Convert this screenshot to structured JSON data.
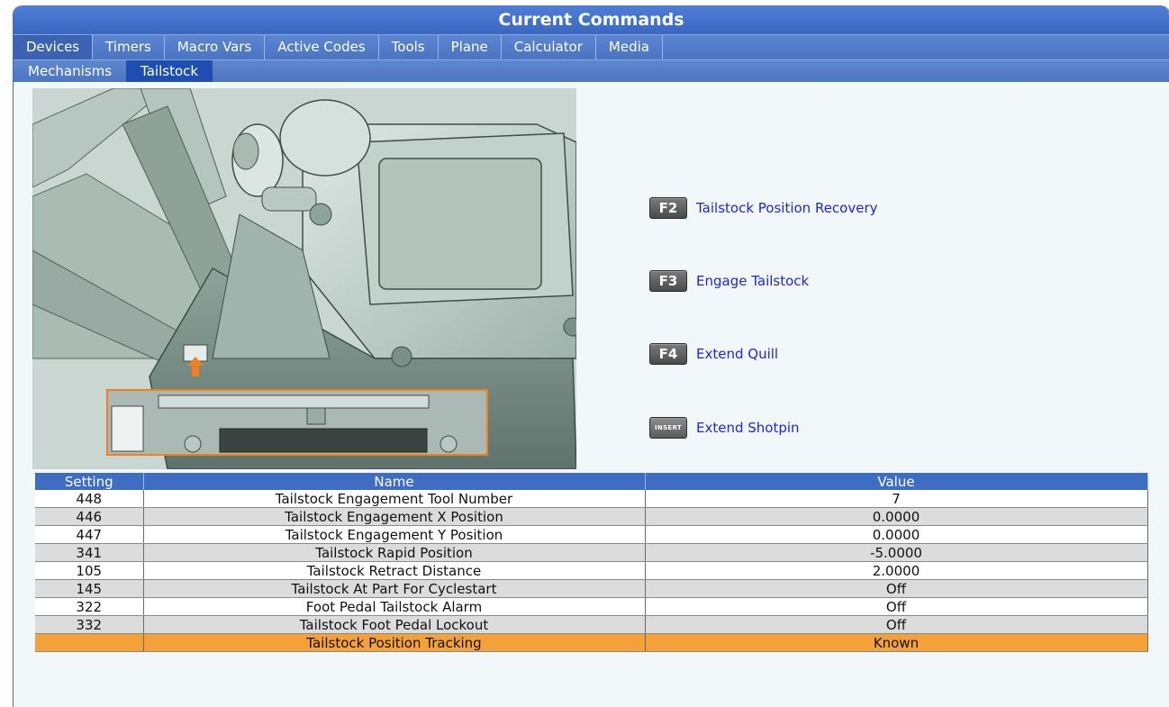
{
  "window": {
    "title": "Current Commands"
  },
  "tabs": [
    {
      "label": "Devices",
      "active": true
    },
    {
      "label": "Timers"
    },
    {
      "label": "Macro Vars"
    },
    {
      "label": "Active Codes"
    },
    {
      "label": "Tools"
    },
    {
      "label": "Plane"
    },
    {
      "label": "Calculator"
    },
    {
      "label": "Media"
    }
  ],
  "subtabs": [
    {
      "label": "Mechanisms"
    },
    {
      "label": "Tailstock",
      "active": true
    }
  ],
  "functions": [
    {
      "key": "F2",
      "label": "Tailstock Position Recovery"
    },
    {
      "key": "F3",
      "label": "Engage Tailstock"
    },
    {
      "key": "F4",
      "label": "Extend Quill"
    },
    {
      "key": "INSERT",
      "label": "Extend Shotpin"
    }
  ],
  "table": {
    "headers": [
      "Setting",
      "Name",
      "Value"
    ],
    "rows": [
      {
        "setting": "448",
        "name": "Tailstock Engagement Tool Number",
        "value": "7"
      },
      {
        "setting": "446",
        "name": "Tailstock Engagement X Position",
        "value": "0.0000"
      },
      {
        "setting": "447",
        "name": "Tailstock Engagement Y Position",
        "value": "0.0000"
      },
      {
        "setting": "341",
        "name": "Tailstock Rapid Position",
        "value": "-5.0000"
      },
      {
        "setting": "105",
        "name": "Tailstock Retract Distance",
        "value": "2.0000"
      },
      {
        "setting": "145",
        "name": "Tailstock At Part For Cyclestart",
        "value": "Off"
      },
      {
        "setting": "322",
        "name": "Foot Pedal Tailstock Alarm",
        "value": "Off"
      },
      {
        "setting": "332",
        "name": "Tailstock Foot Pedal Lockout",
        "value": "Off"
      },
      {
        "setting": "",
        "name": "Tailstock Position Tracking",
        "value": "Known",
        "selected": true
      }
    ]
  },
  "colors": {
    "title_bar": "#3a67c0",
    "active_subtab": "#1e4fb0",
    "selected_row": "#f5a13a",
    "function_label": "#2424d6",
    "callout_border": "#f07f20"
  }
}
